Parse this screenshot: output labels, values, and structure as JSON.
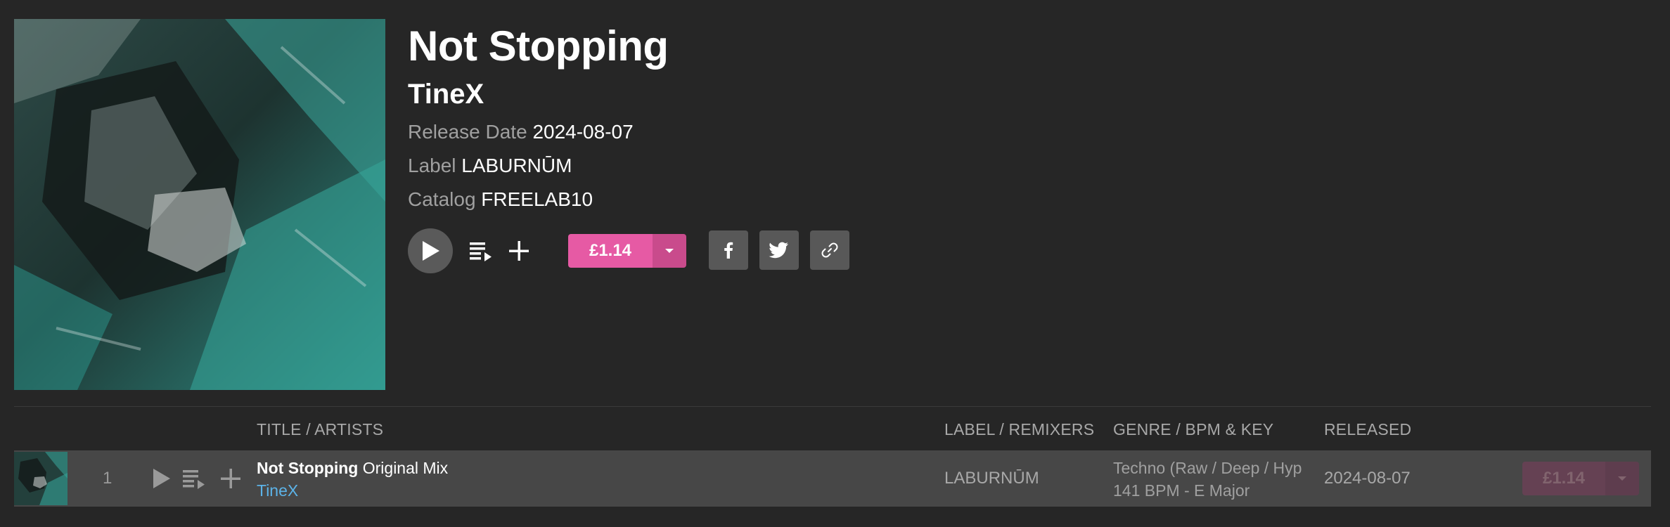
{
  "release": {
    "title": "Not Stopping",
    "artist": "TineX",
    "release_date_label": "Release Date",
    "release_date": "2024-08-07",
    "label_label": "Label",
    "label": "LABURNŪM",
    "catalog_label": "Catalog",
    "catalog": "FREELAB10",
    "price": "£1.14"
  },
  "colors": {
    "accent": "#e65aa4",
    "artist_link": "#5cb3e8",
    "background": "#262626",
    "row_background": "#474747"
  },
  "icons": {
    "play": "play-icon",
    "queue": "queue-icon",
    "add": "plus-icon",
    "dropdown": "chevron-down-icon",
    "facebook": "facebook-icon",
    "twitter": "twitter-icon",
    "link": "link-icon"
  },
  "table": {
    "headers": {
      "title": "TITLE / ARTISTS",
      "label": "LABEL / REMIXERS",
      "genre": "GENRE / BPM & KEY",
      "released": "RELEASED"
    },
    "rows": [
      {
        "number": "1",
        "title": "Not Stopping",
        "mix": "Original Mix",
        "artist": "TineX",
        "label": "LABURNŪM",
        "genre": "Techno (Raw / Deep / Hypnotic)",
        "bpm_key": "141 BPM - E Major",
        "released": "2024-08-07",
        "price": "£1.14"
      }
    ]
  }
}
